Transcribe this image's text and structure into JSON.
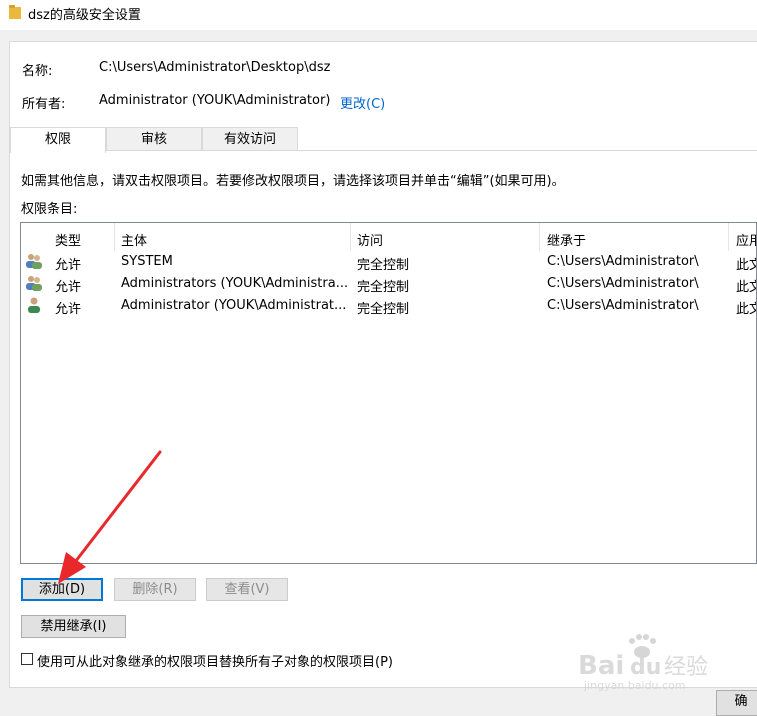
{
  "window": {
    "title": "dsz的高级安全设置"
  },
  "info": {
    "name_label": "名称:",
    "name_value": "C:\\Users\\Administrator\\Desktop\\dsz",
    "owner_label": "所有者:",
    "owner_value": "Administrator (YOUK\\Administrator)",
    "change_link": "更改(C)"
  },
  "tabs": [
    {
      "label": "权限",
      "active": true
    },
    {
      "label": "审核",
      "active": false
    },
    {
      "label": "有效访问",
      "active": false
    }
  ],
  "instructions": "如需其他信息，请双击权限项目。若要修改权限项目，请选择该项目并单击“编辑”(如果可用)。",
  "entries_label": "权限条目:",
  "table": {
    "columns": [
      "类型",
      "主体",
      "访问",
      "继承于",
      "应用"
    ],
    "rows": [
      {
        "icon": "group-users-icon",
        "type": "允许",
        "principal": "SYSTEM",
        "access": "完全控制",
        "inherited": "C:\\Users\\Administrator\\",
        "applies": "此文"
      },
      {
        "icon": "group-users-icon",
        "type": "允许",
        "principal": "Administrators (YOUK\\Administra...",
        "access": "完全控制",
        "inherited": "C:\\Users\\Administrator\\",
        "applies": "此文"
      },
      {
        "icon": "single-user-icon",
        "type": "允许",
        "principal": "Administrator (YOUK\\Administrat...",
        "access": "完全控制",
        "inherited": "C:\\Users\\Administrator\\",
        "applies": "此文"
      }
    ]
  },
  "buttons": {
    "add": "添加(D)",
    "remove": "删除(R)",
    "view": "查看(V)",
    "disable_inheritance": "禁用继承(I)",
    "ok": "确"
  },
  "replace_checkbox": {
    "label": "使用可从此对象继承的权限项目替换所有子对象的权限项目(P)",
    "checked": false
  },
  "watermark": {
    "brand": "Baidu经验",
    "url": "jingyan.baidu.com"
  },
  "colors": {
    "accent": "#0078d7",
    "link": "#0066cc",
    "arrow": "#e8282b"
  }
}
